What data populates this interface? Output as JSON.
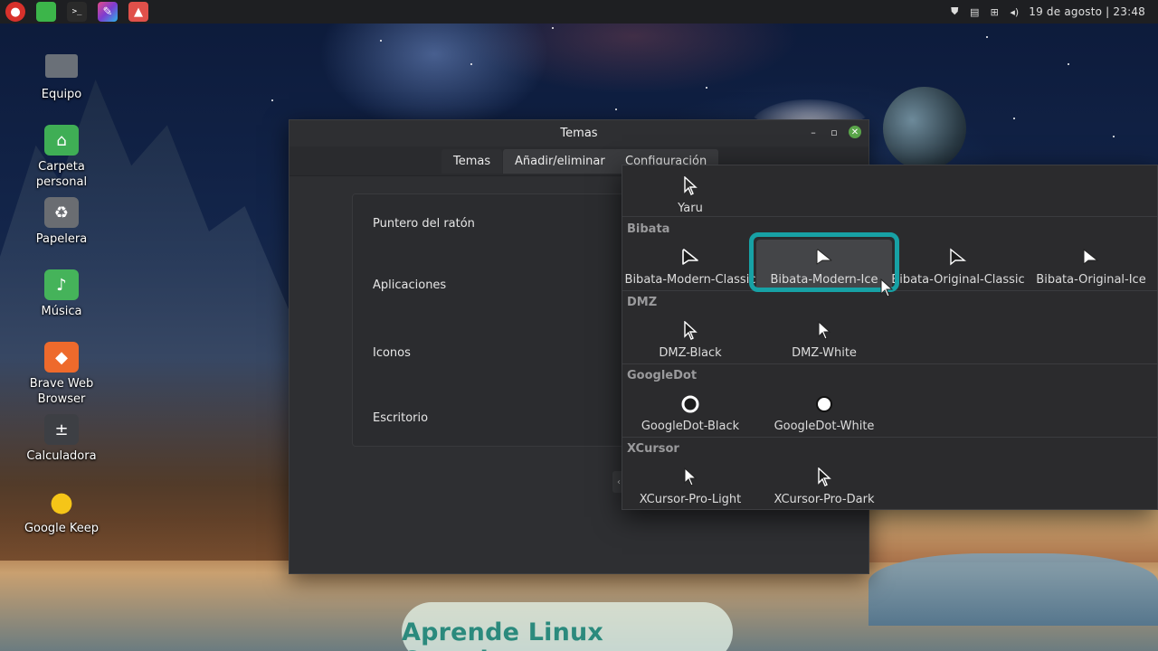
{
  "panel": {
    "launchers": [
      {
        "name": "app-menu",
        "color": "#d8312b",
        "glyph": "●"
      },
      {
        "name": "files",
        "color": "#3cb54a",
        "glyph": "▬"
      },
      {
        "name": "terminal",
        "color": "#2a2a2a",
        "glyph": ">_"
      },
      {
        "name": "text-editor",
        "color": "#b03ac0",
        "glyph": "✎"
      },
      {
        "name": "image-viewer",
        "color": "#e0504a",
        "glyph": "▲"
      }
    ],
    "clock": "19 de agosto | 23:48"
  },
  "desktop": {
    "icons": [
      {
        "label": "Equipo",
        "icon": "computer-icon",
        "color": "#5b6068",
        "glyph": "▭"
      },
      {
        "label": "Carpeta\npersonal",
        "icon": "home-folder-icon",
        "color": "#3fae55",
        "glyph": "⌂"
      },
      {
        "label": "Papelera",
        "icon": "trash-icon",
        "color": "#6a6d72",
        "glyph": "♻"
      },
      {
        "label": "Música",
        "icon": "music-folder-icon",
        "color": "#45b35a",
        "glyph": "♪"
      },
      {
        "label": "Brave Web\nBrowser",
        "icon": "brave-icon",
        "color": "#ee6a2c",
        "glyph": "◆"
      },
      {
        "label": "Calculadora",
        "icon": "calculator-icon",
        "color": "#3d3f44",
        "glyph": "±"
      },
      {
        "label": "Google Keep",
        "icon": "keep-icon",
        "color": "#f5c518",
        "glyph": "●"
      }
    ]
  },
  "window": {
    "title": "Temas",
    "tabs": [
      "Temas",
      "Añadir/eliminar",
      "Configuración"
    ],
    "settings": [
      "Puntero del ratón",
      "Aplicaciones",
      "Iconos",
      "Escritorio"
    ]
  },
  "popup": {
    "top_items": [
      "Yaru"
    ],
    "groups": [
      {
        "name": "Bibata",
        "items": [
          "Bibata-Modern-Classic",
          "Bibata-Modern-Ice",
          "Bibata-Original-Classic",
          "Bibata-Original-Ice"
        ]
      },
      {
        "name": "DMZ",
        "items": [
          "DMZ-Black",
          "DMZ-White"
        ]
      },
      {
        "name": "GoogleDot",
        "items": [
          "GoogleDot-Black",
          "GoogleDot-White"
        ]
      },
      {
        "name": "XCursor",
        "items": [
          "XCursor-Pro-Light",
          "XCursor-Pro-Dark"
        ]
      }
    ],
    "selected": "Bibata-Modern-Ice",
    "highlight_color": "#17a1a5"
  },
  "watermark": "Aprende Linux Conmigo"
}
